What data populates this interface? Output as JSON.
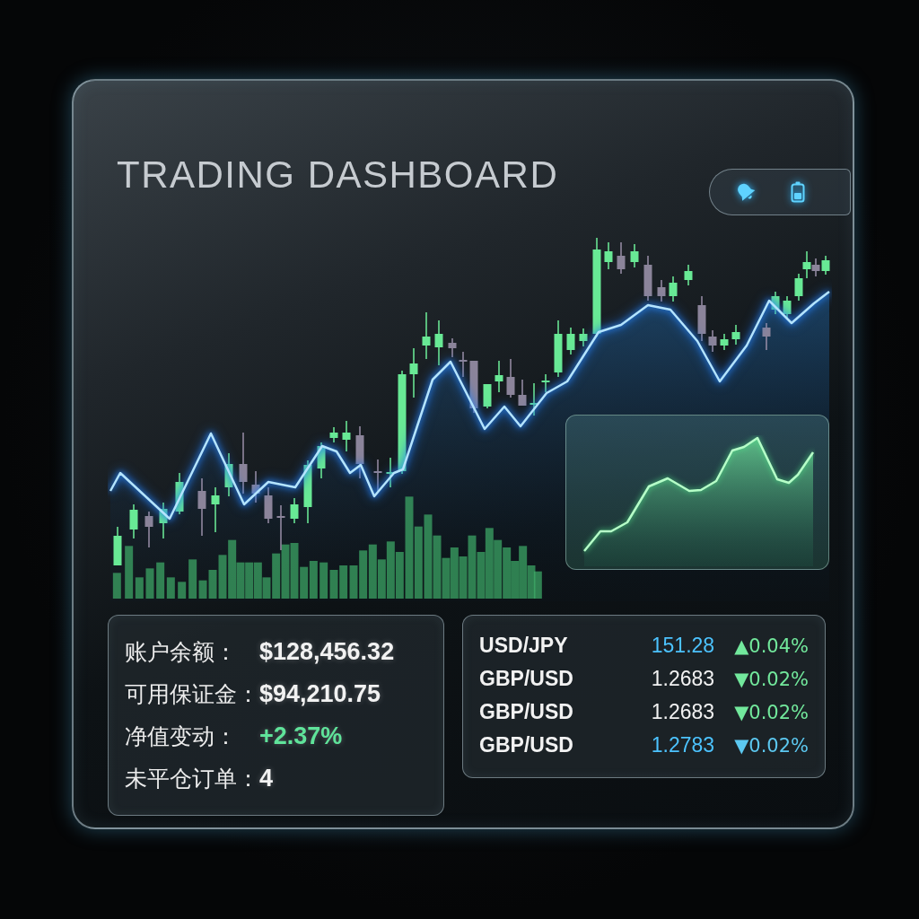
{
  "title": "TRADING DASHBOARD",
  "account": [
    {
      "label": "账户余额：",
      "value": "$128,456.32",
      "color": "#f2f2f2"
    },
    {
      "label": "可用保证金：",
      "value": "$94,210.75",
      "color": "#f2f2f2"
    },
    {
      "label": "净值变动：",
      "value": "+2.37%",
      "color": "#5fe39a"
    },
    {
      "label": "未平仓订单：",
      "value": "4",
      "color": "#f2f2f2"
    }
  ],
  "quotes": [
    {
      "pair": "USD/JPY",
      "price": {
        "value": "151.28",
        "color": "#4cc3ff"
      },
      "change": {
        "value": "▲0.04%",
        "color": "#72e89c"
      }
    },
    {
      "pair": "GBP/USD",
      "price": {
        "value": "1.2683",
        "color": "#f2f2f2"
      },
      "change": {
        "value": "▼0.02%",
        "color": "#72e89c"
      }
    },
    {
      "pair": "GBP/USD",
      "price": {
        "value": "1.2683",
        "color": "#f2f2f2"
      },
      "change": {
        "value": "▼0.02%",
        "color": "#72e89c"
      }
    },
    {
      "pair": "GBP/USD",
      "price": {
        "value": "1.2783",
        "color": "#4cc3ff"
      },
      "change": {
        "value": "▼0.02%",
        "color": "#5cc8f0"
      }
    }
  ]
}
